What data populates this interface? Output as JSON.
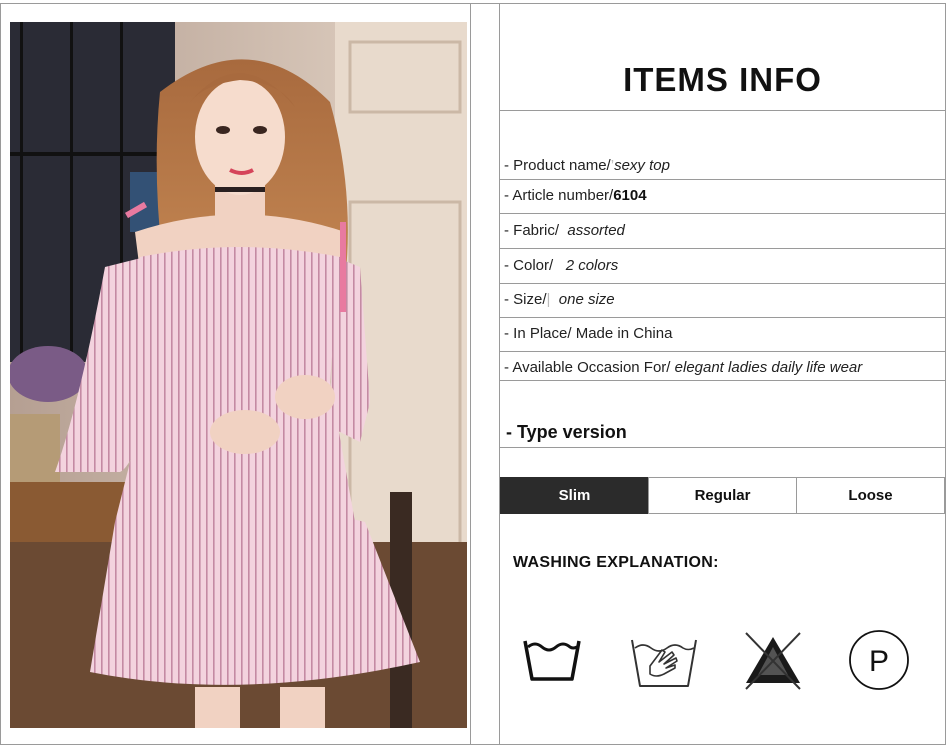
{
  "info": {
    "title": "ITEMS INFO",
    "rows": [
      {
        "label": "- Product name/",
        "sep": "’",
        "value": "sexy top"
      },
      {
        "label": "- Article number/",
        "sep": "",
        "value": "6104"
      },
      {
        "label": "- Fabric/",
        "sep": "",
        "value": "assorted"
      },
      {
        "label": "- Color/",
        "sep": "",
        "value": "2 colors"
      },
      {
        "label": "- Size/",
        "sep": "|",
        "value": "one size"
      },
      {
        "label": "- In Place/",
        "sep": "",
        "value": "Made in China"
      },
      {
        "label": "- Available Occasion For/",
        "sep": "",
        "value": "elegant ladies daily life wear"
      }
    ],
    "type_title": "- Type version",
    "versions": [
      "Slim",
      "Regular",
      "Loose"
    ],
    "active_version": "Slim",
    "washing_title": "WASHING EXPLANATION:",
    "washing_icons": [
      "machine-wash-icon",
      "hand-wash-icon",
      "do-not-bleach-icon",
      "dry-clean-p-icon"
    ],
    "dry_clean_letter": "P"
  },
  "colors": {
    "border": "#9a9a9a",
    "active_tab": "#2b2b2b",
    "dress_pink": "#efc4d2"
  }
}
